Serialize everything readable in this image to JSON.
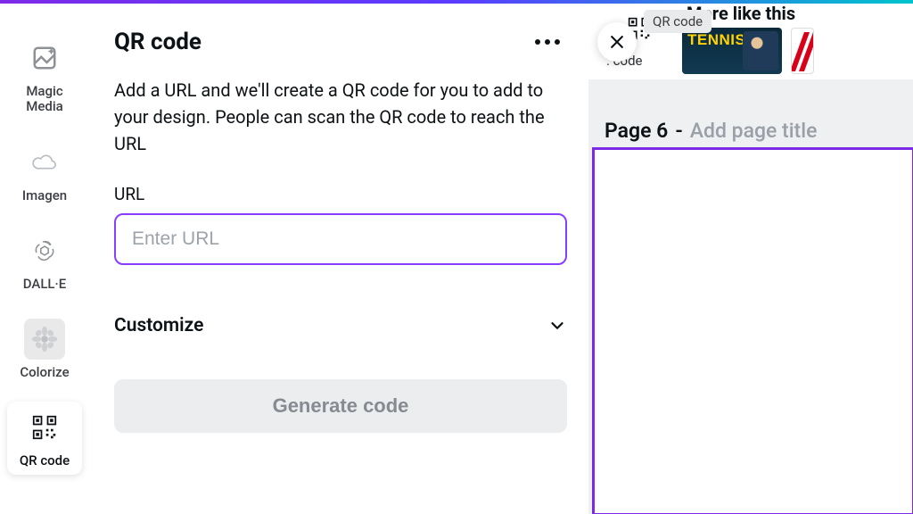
{
  "sidebar": {
    "items": [
      {
        "label": "Magic Media",
        "icon": "magic-media-icon"
      },
      {
        "label": "Imagen",
        "icon": "cloud-icon"
      },
      {
        "label": "DALL·E",
        "icon": "openai-icon"
      },
      {
        "label": "Colorize",
        "icon": "flower-icon"
      },
      {
        "label": "QR code",
        "icon": "qr-icon"
      }
    ]
  },
  "panel": {
    "title": "QR code",
    "description": "Add a URL and we'll create a QR code for you to add to your design. People can scan the QR code to reach the URL",
    "url_label": "URL",
    "url_placeholder": "Enter URL",
    "customize_label": "Customize",
    "generate_label": "Generate code"
  },
  "preview": {
    "tooltip": "QR code",
    "qr_tile_label": ". code",
    "more_like": "More like this",
    "thumb1_text": "TENNIS",
    "page_label": "Page 6",
    "page_dash": "-",
    "page_title_placeholder": "Add page title"
  }
}
